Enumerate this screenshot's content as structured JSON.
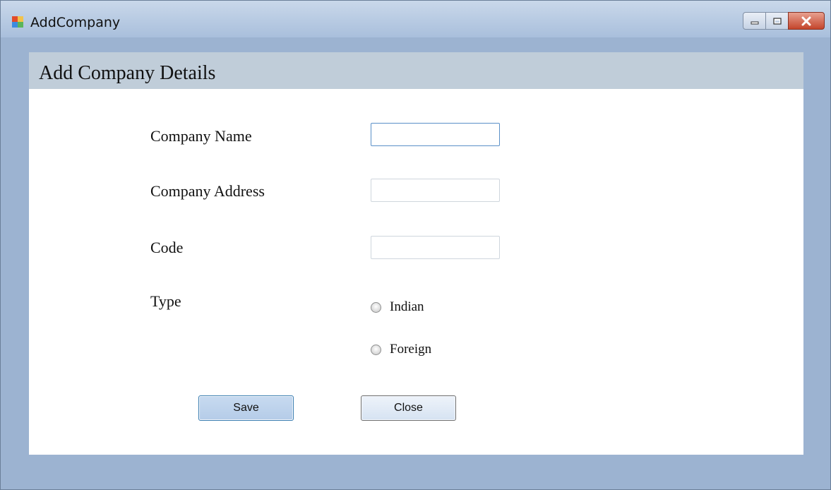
{
  "window": {
    "title": "AddCompany",
    "icon": "app-window-icon",
    "controls": [
      "minimize-icon",
      "maximize-icon",
      "close-icon"
    ]
  },
  "header": {
    "title": "Add Company Details"
  },
  "form": {
    "company_name_label": "Company Name",
    "company_name_value": "",
    "company_address_label": "Company Address",
    "company_address_value": "",
    "code_label": "Code",
    "code_value": "",
    "type_label": "Type",
    "type_options": [
      {
        "label": "Indian",
        "selected": false
      },
      {
        "label": "Foreign",
        "selected": false
      }
    ]
  },
  "actions": {
    "save_label": "Save",
    "close_label": "Close"
  },
  "colors": {
    "window_frame": "#9cb3d1",
    "header_band": "#c0cdd9",
    "save_button": "#b5cce8",
    "close_button": "#c4452c"
  }
}
